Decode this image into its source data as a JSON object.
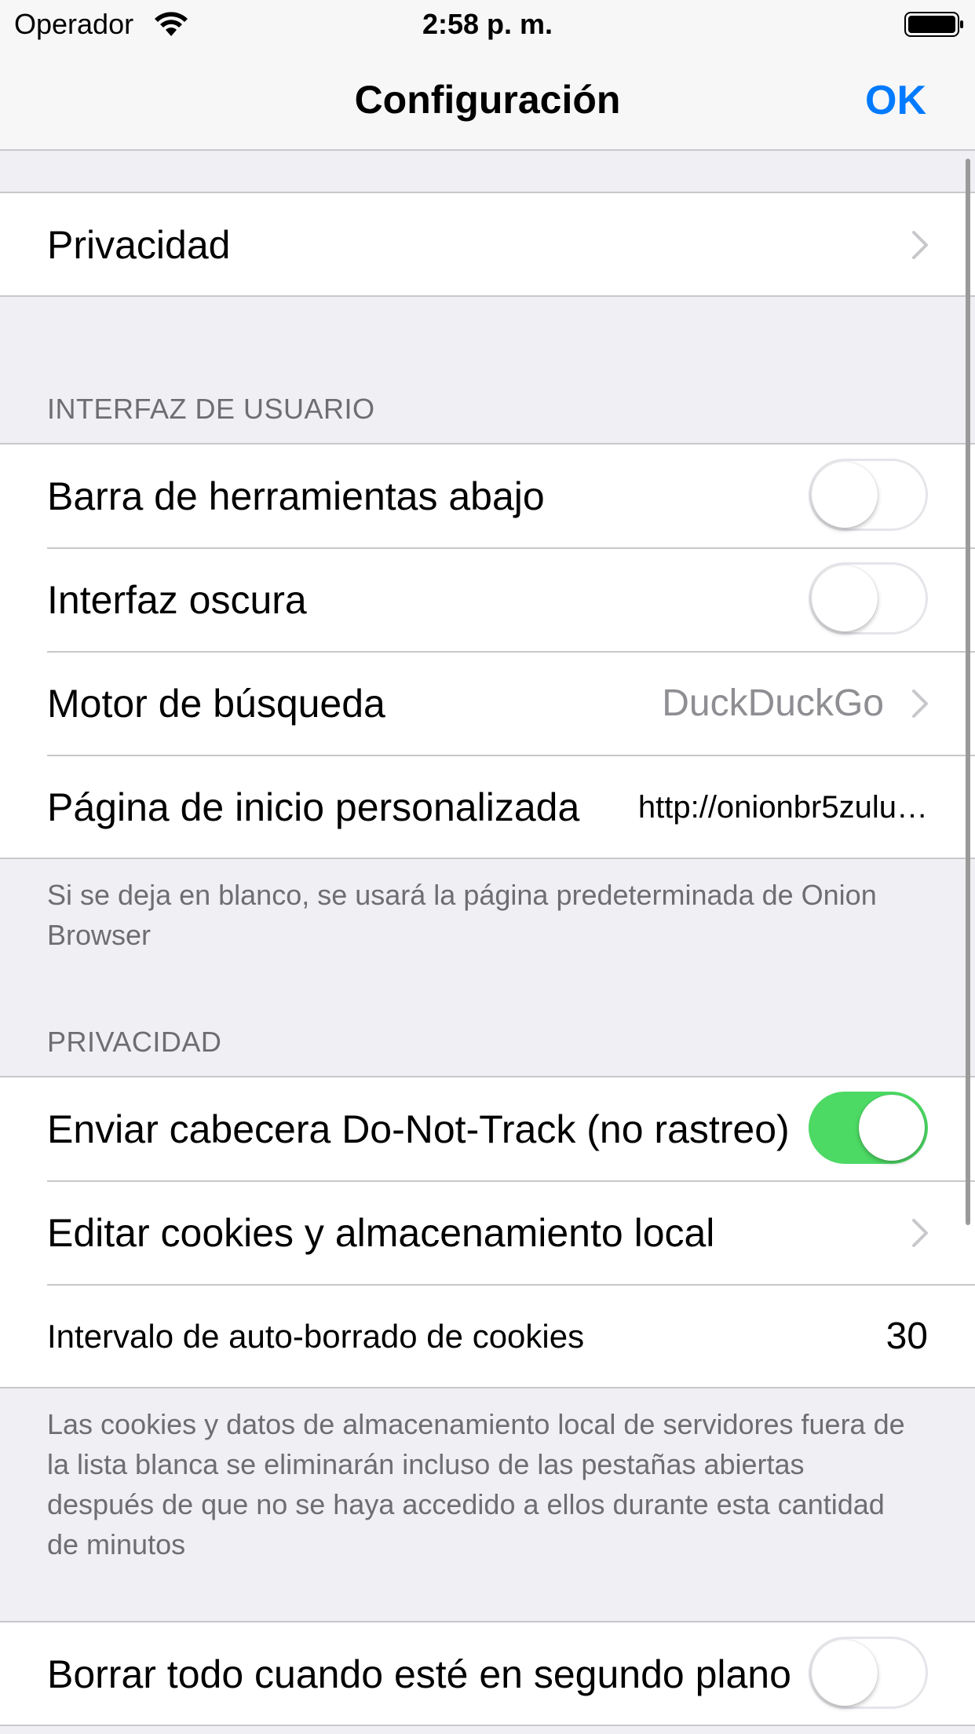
{
  "status": {
    "carrier": "Operador",
    "time": "2:58 p. m."
  },
  "nav": {
    "title": "Configuración",
    "done": "OK"
  },
  "colors": {
    "accent": "#007aff",
    "toggle_on": "#4cd964"
  },
  "group1": {
    "privacy_row": "Privacidad"
  },
  "ui_section": {
    "header": "INTERFAZ DE USUARIO",
    "toolbar_bottom": {
      "label": "Barra de herramientas abajo",
      "on": false
    },
    "dark_interface": {
      "label": "Interfaz oscura",
      "on": false
    },
    "search_engine": {
      "label": "Motor de búsqueda",
      "value": "DuckDuckGo"
    },
    "homepage": {
      "label": "Página de inicio personalizada",
      "value": "http://onionbr5zulu…"
    },
    "footer": "Si se deja en blanco, se usará la página predeterminada de Onion Browser"
  },
  "privacy_section": {
    "header": "PRIVACIDAD",
    "dnt": {
      "label": "Enviar cabecera Do-Not-Track (no rastreo)",
      "on": true
    },
    "cookies": {
      "label": "Editar cookies y almacenamiento local"
    },
    "autoclear": {
      "label": "Intervalo de auto-borrado de cookies",
      "value": "30"
    },
    "footer": "Las cookies y datos de almacenamiento local de servidores fuera de la lista blanca se eliminarán incluso de las pestañas abiertas después de que no se haya accedido a ellos durante esta cantidad de minutos"
  },
  "background_section": {
    "clear_all": {
      "label": "Borrar todo cuando esté en segundo plano",
      "on": false
    }
  }
}
